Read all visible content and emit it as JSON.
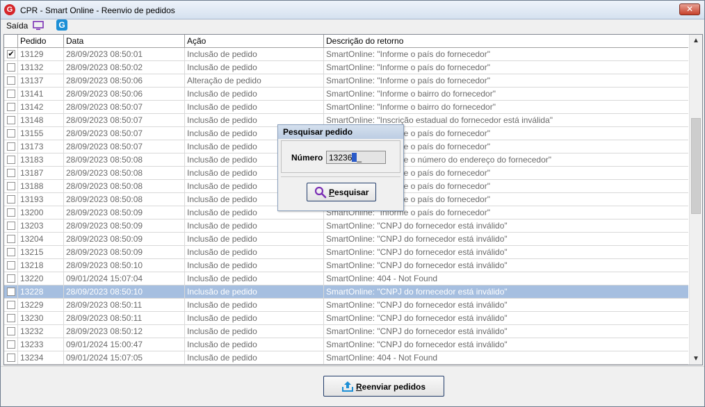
{
  "window": {
    "title": "CPR - Smart Online - Reenvio de pedidos",
    "app_icon_letter": "G",
    "close_symbol": "✕"
  },
  "menu": {
    "saida_label": "Saída",
    "icons": [
      "monitor-icon",
      "app-icon"
    ],
    "app_icon_letter": "G"
  },
  "grid": {
    "headers": [
      "Pedido",
      "Data",
      "Ação",
      "Descrição do retorno"
    ],
    "rows": [
      {
        "checked": true,
        "pedido": "13129",
        "data": "28/09/2023 08:50:01",
        "acao": "Inclusão de pedido",
        "descricao": "SmartOnline: \"Informe o país do fornecedor\""
      },
      {
        "checked": false,
        "pedido": "13132",
        "data": "28/09/2023 08:50:02",
        "acao": "Inclusão de pedido",
        "descricao": "SmartOnline: \"Informe o país do fornecedor\""
      },
      {
        "checked": false,
        "pedido": "13137",
        "data": "28/09/2023 08:50:06",
        "acao": "Alteração de pedido",
        "descricao": "SmartOnline: \"Informe o país do fornecedor\""
      },
      {
        "checked": false,
        "pedido": "13141",
        "data": "28/09/2023 08:50:06",
        "acao": "Inclusão de pedido",
        "descricao": "SmartOnline: \"Informe o bairro do fornecedor\""
      },
      {
        "checked": false,
        "pedido": "13142",
        "data": "28/09/2023 08:50:07",
        "acao": "Inclusão de pedido",
        "descricao": "SmartOnline: \"Informe o bairro do fornecedor\""
      },
      {
        "checked": false,
        "pedido": "13148",
        "data": "28/09/2023 08:50:07",
        "acao": "Inclusão de pedido",
        "descricao": "SmartOnline: \"Inscrição estadual do fornecedor está inválida\""
      },
      {
        "checked": false,
        "pedido": "13155",
        "data": "28/09/2023 08:50:07",
        "acao": "Inclusão de pedido",
        "descricao": "SmartOnline: \"Informe o país do fornecedor\""
      },
      {
        "checked": false,
        "pedido": "13173",
        "data": "28/09/2023 08:50:07",
        "acao": "Inclusão de pedido",
        "descricao": "SmartOnline: \"Informe o país do fornecedor\""
      },
      {
        "checked": false,
        "pedido": "13183",
        "data": "28/09/2023 08:50:08",
        "acao": "Inclusão de pedido",
        "descricao": "SmartOnline: \"Informe o número do endereço do fornecedor\""
      },
      {
        "checked": false,
        "pedido": "13187",
        "data": "28/09/2023 08:50:08",
        "acao": "Inclusão de pedido",
        "descricao": "SmartOnline: \"Informe o país do fornecedor\""
      },
      {
        "checked": false,
        "pedido": "13188",
        "data": "28/09/2023 08:50:08",
        "acao": "Inclusão de pedido",
        "descricao": "SmartOnline: \"Informe o país do fornecedor\""
      },
      {
        "checked": false,
        "pedido": "13193",
        "data": "28/09/2023 08:50:08",
        "acao": "Inclusão de pedido",
        "descricao": "SmartOnline: \"Informe o país do fornecedor\""
      },
      {
        "checked": false,
        "pedido": "13200",
        "data": "28/09/2023 08:50:09",
        "acao": "Inclusão de pedido",
        "descricao": "SmartOnline: \"Informe o país do fornecedor\""
      },
      {
        "checked": false,
        "pedido": "13203",
        "data": "28/09/2023 08:50:09",
        "acao": "Inclusão de pedido",
        "descricao": "SmartOnline: \"CNPJ do fornecedor está inválido\""
      },
      {
        "checked": false,
        "pedido": "13204",
        "data": "28/09/2023 08:50:09",
        "acao": "Inclusão de pedido",
        "descricao": "SmartOnline: \"CNPJ do fornecedor está inválido\""
      },
      {
        "checked": false,
        "pedido": "13215",
        "data": "28/09/2023 08:50:09",
        "acao": "Inclusão de pedido",
        "descricao": "SmartOnline: \"CNPJ do fornecedor está inválido\""
      },
      {
        "checked": false,
        "pedido": "13218",
        "data": "28/09/2023 08:50:10",
        "acao": "Inclusão de pedido",
        "descricao": "SmartOnline: \"CNPJ do fornecedor está inválido\""
      },
      {
        "checked": false,
        "pedido": "13220",
        "data": "09/01/2024 15:07:04",
        "acao": "Inclusão de pedido",
        "descricao": "SmartOnline: 404 - Not Found"
      },
      {
        "checked": false,
        "pedido": "13228",
        "data": "28/09/2023 08:50:10",
        "acao": "Inclusão de pedido",
        "descricao": "SmartOnline: \"CNPJ do fornecedor está inválido\"",
        "selected": true
      },
      {
        "checked": false,
        "pedido": "13229",
        "data": "28/09/2023 08:50:11",
        "acao": "Inclusão de pedido",
        "descricao": "SmartOnline: \"CNPJ do fornecedor está inválido\""
      },
      {
        "checked": false,
        "pedido": "13230",
        "data": "28/09/2023 08:50:11",
        "acao": "Inclusão de pedido",
        "descricao": "SmartOnline: \"CNPJ do fornecedor está inválido\""
      },
      {
        "checked": false,
        "pedido": "13232",
        "data": "28/09/2023 08:50:12",
        "acao": "Inclusão de pedido",
        "descricao": "SmartOnline: \"CNPJ do fornecedor está inválido\""
      },
      {
        "checked": false,
        "pedido": "13233",
        "data": "09/01/2024 15:00:47",
        "acao": "Inclusão de pedido",
        "descricao": "SmartOnline: \"CNPJ do fornecedor está inválido\""
      },
      {
        "checked": false,
        "pedido": "13234",
        "data": "09/01/2024 15:07:05",
        "acao": "Inclusão de pedido",
        "descricao": "SmartOnline: 404 - Not Found"
      }
    ]
  },
  "dialog": {
    "title": "Pesquisar pedido",
    "numero_label": "Número",
    "numero_value": "13236",
    "search_button_label": "Pesquisar",
    "search_button_mnemonic": "P"
  },
  "footer": {
    "resend_button_label": "Reenviar pedidos",
    "resend_button_mnemonic": "R"
  },
  "colors": {
    "selection": "#a6bfe0",
    "accent_blue": "#1c8fd6",
    "brand_red": "#d6262b",
    "icon_purple": "#7b2fb5"
  }
}
